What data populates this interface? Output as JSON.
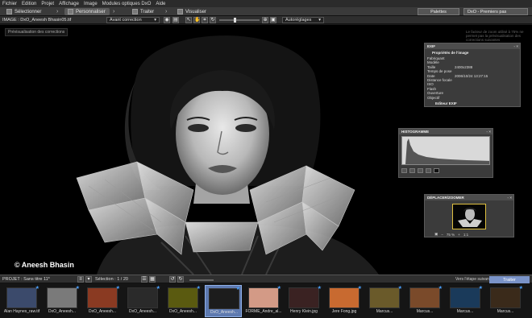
{
  "menubar": {
    "items": [
      "Fichier",
      "Edition",
      "Projet",
      "Affichage",
      "Image",
      "Modules optiques DxO",
      "Aide"
    ]
  },
  "workflow": {
    "tabs": [
      {
        "num": "1",
        "label": "Sélectionner"
      },
      {
        "num": "2",
        "label": "Personnaliser"
      },
      {
        "num": "3",
        "label": "Traiter"
      },
      {
        "num": "4",
        "label": "Visualiser"
      }
    ],
    "palettes_label": "Palettes",
    "workspace_label": "DxO - Premiers pas"
  },
  "toolbar": {
    "image_label": "IMAGE : DxO_Aneesh Bhasin05.tif",
    "compare_select": "Avant correction",
    "autoalign_select": "Autoréglages",
    "icons": [
      "eye-icon",
      "hand-icon",
      "crop-icon",
      "rotate-icon",
      "zoom-icon"
    ]
  },
  "viewer": {
    "preview_label": "Prévisualisation des corrections",
    "faint_note": "Le facteur de zoom utilisé à 75% ne permet pas la prévisualisation des corrections suivantes",
    "copyright": "© Aneesh Bhasin"
  },
  "exif_panel": {
    "title": "EXIF",
    "section": "Propriétés de l'image",
    "rows": [
      {
        "k": "Fabriquant",
        "v": ""
      },
      {
        "k": "Modèle",
        "v": ""
      },
      {
        "k": "Taille",
        "v": "2400x2388"
      },
      {
        "k": "Temps de pose",
        "v": ""
      },
      {
        "k": "Date",
        "v": "2006/10/24 13:27:15"
      },
      {
        "k": "Distance focale",
        "v": ""
      },
      {
        "k": "ISO",
        "v": ""
      },
      {
        "k": "Flash",
        "v": ""
      },
      {
        "k": "Ouverture",
        "v": ""
      },
      {
        "k": "Objectif",
        "v": ""
      }
    ],
    "footer": "Editeur EXIF"
  },
  "histogram_panel": {
    "title": "HISTOGRAMME"
  },
  "navigator_panel": {
    "title": "DÉPLACER/ZOOMER",
    "zoom": "75 %"
  },
  "filmstrip": {
    "projet_label": "PROJET :  Sans titre 11*",
    "selection_label": "Sélection : 1 / 20",
    "next_label": "Vers l'étape suivante",
    "traiter_label": "Traiter",
    "thumbs": [
      {
        "name": "Alan Haynes_raw.tif",
        "color": "#3b4a6b"
      },
      {
        "name": "DxO_Aneesh...",
        "color": "#7a7a7a"
      },
      {
        "name": "DxO_Aneesh...",
        "color": "#8a3a22"
      },
      {
        "name": "DxO_Aneesh...",
        "color": "#2a2a2a"
      },
      {
        "name": "DxO_Aneesh...",
        "color": "#5a5a10"
      },
      {
        "name": "DxO_Aneesh...",
        "color": "#1c1c1c",
        "selected": true
      },
      {
        "name": "FORME_Andre_al...",
        "color": "#d39a86"
      },
      {
        "name": "Henry Klein.jpg",
        "color": "#3a2222"
      },
      {
        "name": "Jere Fong.jpg",
        "color": "#c86a30"
      },
      {
        "name": "Marcus...",
        "color": "#6a5a2a"
      },
      {
        "name": "Marcus...",
        "color": "#7a4a2a"
      },
      {
        "name": "Marcus...",
        "color": "#1a3a5a"
      },
      {
        "name": "Marcus...",
        "color": "#3a2a1a"
      }
    ]
  }
}
